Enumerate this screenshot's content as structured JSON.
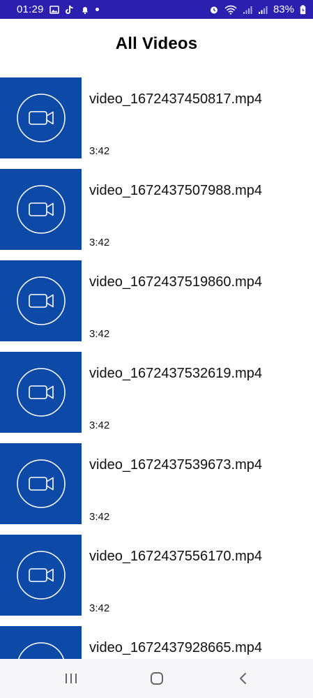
{
  "status_bar": {
    "time": "01:29",
    "battery_percent": "83%",
    "icons_left": [
      "image-icon",
      "tiktok-icon",
      "bell-icon",
      "dot-icon"
    ],
    "icons_right": [
      "alarm-icon",
      "wifi-icon",
      "signal-icon",
      "signal-icon",
      "battery-icon"
    ],
    "background_color": "#2b1fb0"
  },
  "header": {
    "title": "All Videos"
  },
  "theme": {
    "thumbnail_color": "#0d4aa8"
  },
  "videos": [
    {
      "name": "video_1672437450817.mp4",
      "duration": "3:42",
      "icon": "video-camera-icon"
    },
    {
      "name": "video_1672437507988.mp4",
      "duration": "3:42",
      "icon": "video-camera-icon"
    },
    {
      "name": "video_1672437519860.mp4",
      "duration": "3:42",
      "icon": "video-camera-icon"
    },
    {
      "name": "video_1672437532619.mp4",
      "duration": "3:42",
      "icon": "video-camera-icon"
    },
    {
      "name": "video_1672437539673.mp4",
      "duration": "3:42",
      "icon": "video-camera-icon"
    },
    {
      "name": "video_1672437556170.mp4",
      "duration": "3:42",
      "icon": "video-camera-icon"
    },
    {
      "name": "video_1672437928665.mp4",
      "duration": "",
      "icon": "video-camera-icon"
    }
  ],
  "nav_bar": {
    "buttons": [
      "recent-apps-icon",
      "home-icon",
      "back-icon"
    ]
  }
}
